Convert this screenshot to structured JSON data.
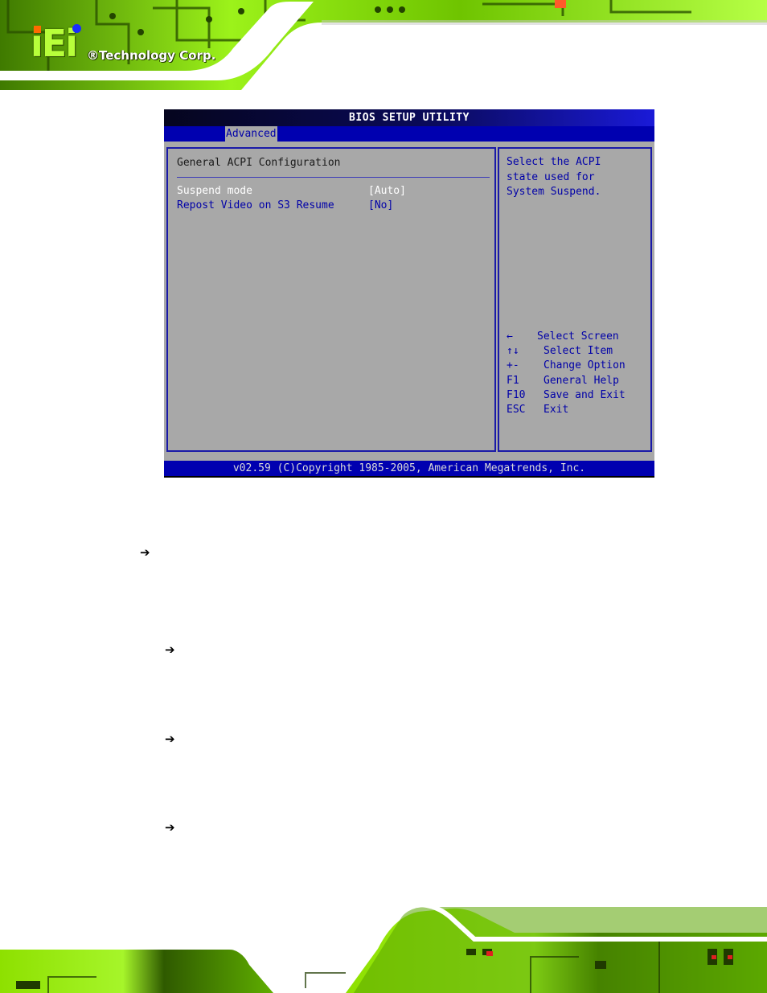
{
  "header": {
    "logo_mark": "iEi",
    "logo_text": "®Technology Corp."
  },
  "colors": {
    "pcb_green": "#8cf000",
    "pcb_dark": "#1f3a00",
    "bios_blue": "#0000b0",
    "bios_gray": "#a8a8a8",
    "bios_text_blue": "#0000a8"
  },
  "bios": {
    "title": "BIOS SETUP UTILITY",
    "tabs": [
      {
        "label": "Advanced",
        "active": true
      }
    ],
    "section_title": "General ACPI Configuration",
    "options": [
      {
        "label": "Suspend mode",
        "value": "[Auto]",
        "selected": true
      },
      {
        "label": "Repost Video on S3 Resume",
        "value": "[No]",
        "selected": false
      }
    ],
    "help_lines": [
      "Select the ACPI",
      "state used for",
      "System Suspend."
    ],
    "keys": [
      {
        "key": "←",
        "desc": "Select Screen"
      },
      {
        "key": "↑↓",
        "desc": "Select Item"
      },
      {
        "key": "+-",
        "desc": "Change Option"
      },
      {
        "key": "F1",
        "desc": "General Help"
      },
      {
        "key": "F10",
        "desc": "Save and Exit"
      },
      {
        "key": "ESC",
        "desc": "Exit"
      }
    ],
    "footer": "v02.59 (C)Copyright 1985-2005, American Megatrends, Inc."
  },
  "document": {
    "arrow_glyph": "➔",
    "arrow_icons": [
      "arrow-right-icon",
      "arrow-right-icon",
      "arrow-right-icon",
      "arrow-right-icon"
    ]
  }
}
